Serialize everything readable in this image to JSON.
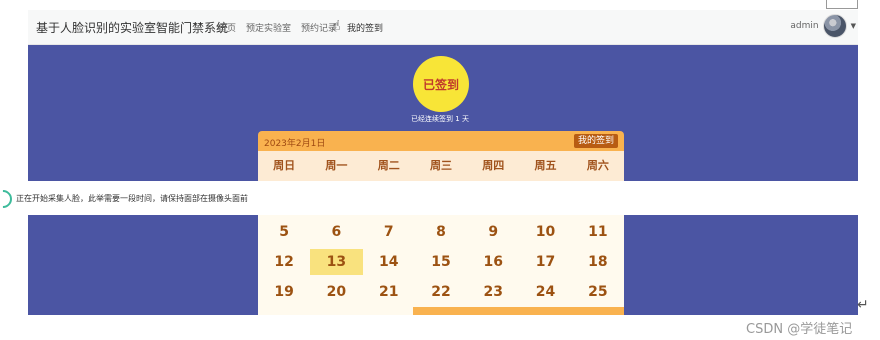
{
  "header": {
    "title": "基于人脸识别的实验室智能门禁系统",
    "nav": [
      "首页",
      "预定实验室",
      "预约记录",
      "我的签到"
    ],
    "active_index": 3,
    "user": "admin"
  },
  "signin": {
    "badge": "已签到",
    "streak": "已经连续签到 1 天"
  },
  "calendar": {
    "current_date": "2023年2月1日",
    "my_signin_button": "我的签到",
    "weekdays": [
      "周日",
      "周一",
      "周二",
      "周三",
      "周四",
      "周五",
      "周六"
    ],
    "rows": [
      [
        "5",
        "6",
        "7",
        "8",
        "9",
        "10",
        "11"
      ],
      [
        "12",
        "13",
        "14",
        "15",
        "16",
        "17",
        "18"
      ],
      [
        "19",
        "20",
        "21",
        "22",
        "23",
        "24",
        "25"
      ]
    ],
    "today": "13"
  },
  "notice": {
    "text": "正在开始采集人脸，此举需要一段时间，请保持面部在摄像头面前"
  },
  "watermark": "CSDN @学徒笔记",
  "colors": {
    "banner": "#4b55a3",
    "badge": "#f8e537",
    "calendar_accent": "#f9b24f",
    "notice_icon": "#3dbb9b"
  }
}
